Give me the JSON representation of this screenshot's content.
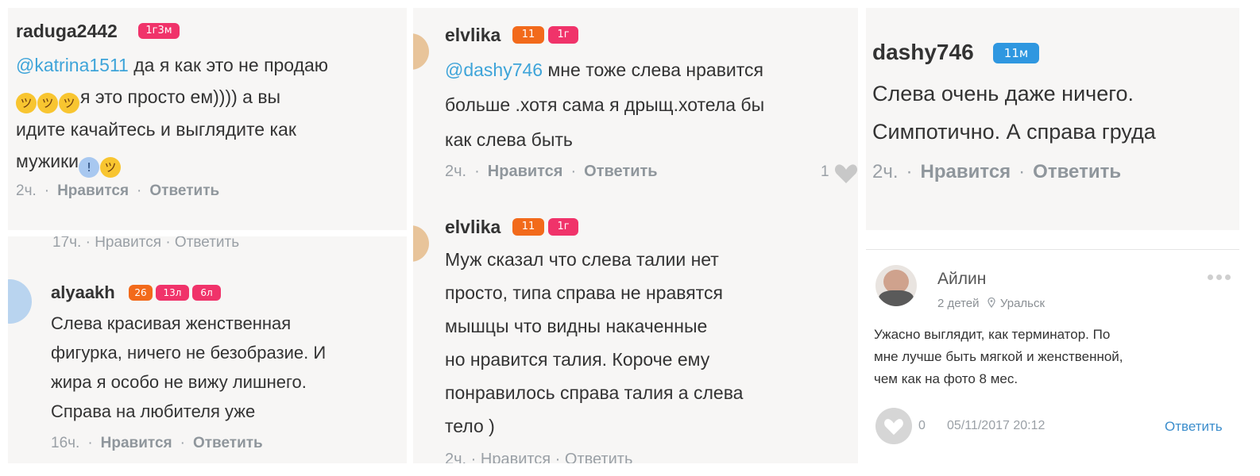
{
  "comments": [
    {
      "user": "raduga2442",
      "badges": [
        "1г3м"
      ],
      "mention": "@katrina1511",
      "lines": [
        " да я как это не продаю",
        "я это просто ем)))) а вы",
        "идите качайтесь и выглядите как",
        "мужики"
      ],
      "time": "2ч.",
      "like": "Нравится",
      "reply": "Ответить"
    },
    {
      "cut_meta": "17ч. · Нравится · Ответить",
      "user": "alyaakh",
      "badges": [
        "26",
        "13л",
        "6л"
      ],
      "lines": [
        "Слева красивая женственная",
        "фигурка, ничего не безобразие. И",
        "жира я особо не вижу лишнего.",
        "Справа на любителя уже"
      ],
      "time": "16ч.",
      "like": "Нравится",
      "reply": "Ответить"
    },
    {
      "user": "elvlika",
      "badges": [
        "11",
        "1г"
      ],
      "mention": "@dashy746",
      "lines": [
        " мне тоже слева нравится",
        "больше .хотя сама я дрыщ.хотела бы",
        "как  слева быть"
      ],
      "time": "2ч.",
      "like": "Нравится",
      "reply": "Ответить",
      "likes_count": "1"
    },
    {
      "user": "elvlika",
      "badges": [
        "11",
        "1г"
      ],
      "lines": [
        "Муж сказал что слева талии нет",
        "просто, типа справа не нравятся",
        "мышцы что видны накаченные",
        "но нравится талия. Короче ему",
        "понравилось справа талия а слева",
        "тело )"
      ],
      "cut_meta": "2ч. · Нравится · Ответить"
    },
    {
      "user": "dashy746",
      "badges": [
        "11м"
      ],
      "lines": [
        "Слева очень даже ничего.",
        "Симпотично. А справа груда"
      ],
      "time": "2ч.",
      "like": "Нравится",
      "reply": "Ответить"
    },
    {
      "name": "Айлин",
      "kids": "2 детей",
      "city": "Уральск",
      "lines": [
        "Ужасно выглядит, как терминатор. По",
        "мне лучше быть мягкой и женственной,",
        "чем как на фото 8 мес."
      ],
      "likes_count": "0",
      "date": "05/11/2017 20:12",
      "reply": "Ответить"
    }
  ],
  "colors": {
    "badge_pink": "#f0336a",
    "badge_orange": "#f26a1b",
    "badge_blue": "#2f97e0",
    "mention": "#3ea4d9",
    "panel_bg": "#f7f6f5"
  },
  "icons": [
    "laughing-emoji-icon",
    "scream-emoji-icon",
    "heart-icon",
    "location-pin-icon",
    "more-dots-icon"
  ]
}
